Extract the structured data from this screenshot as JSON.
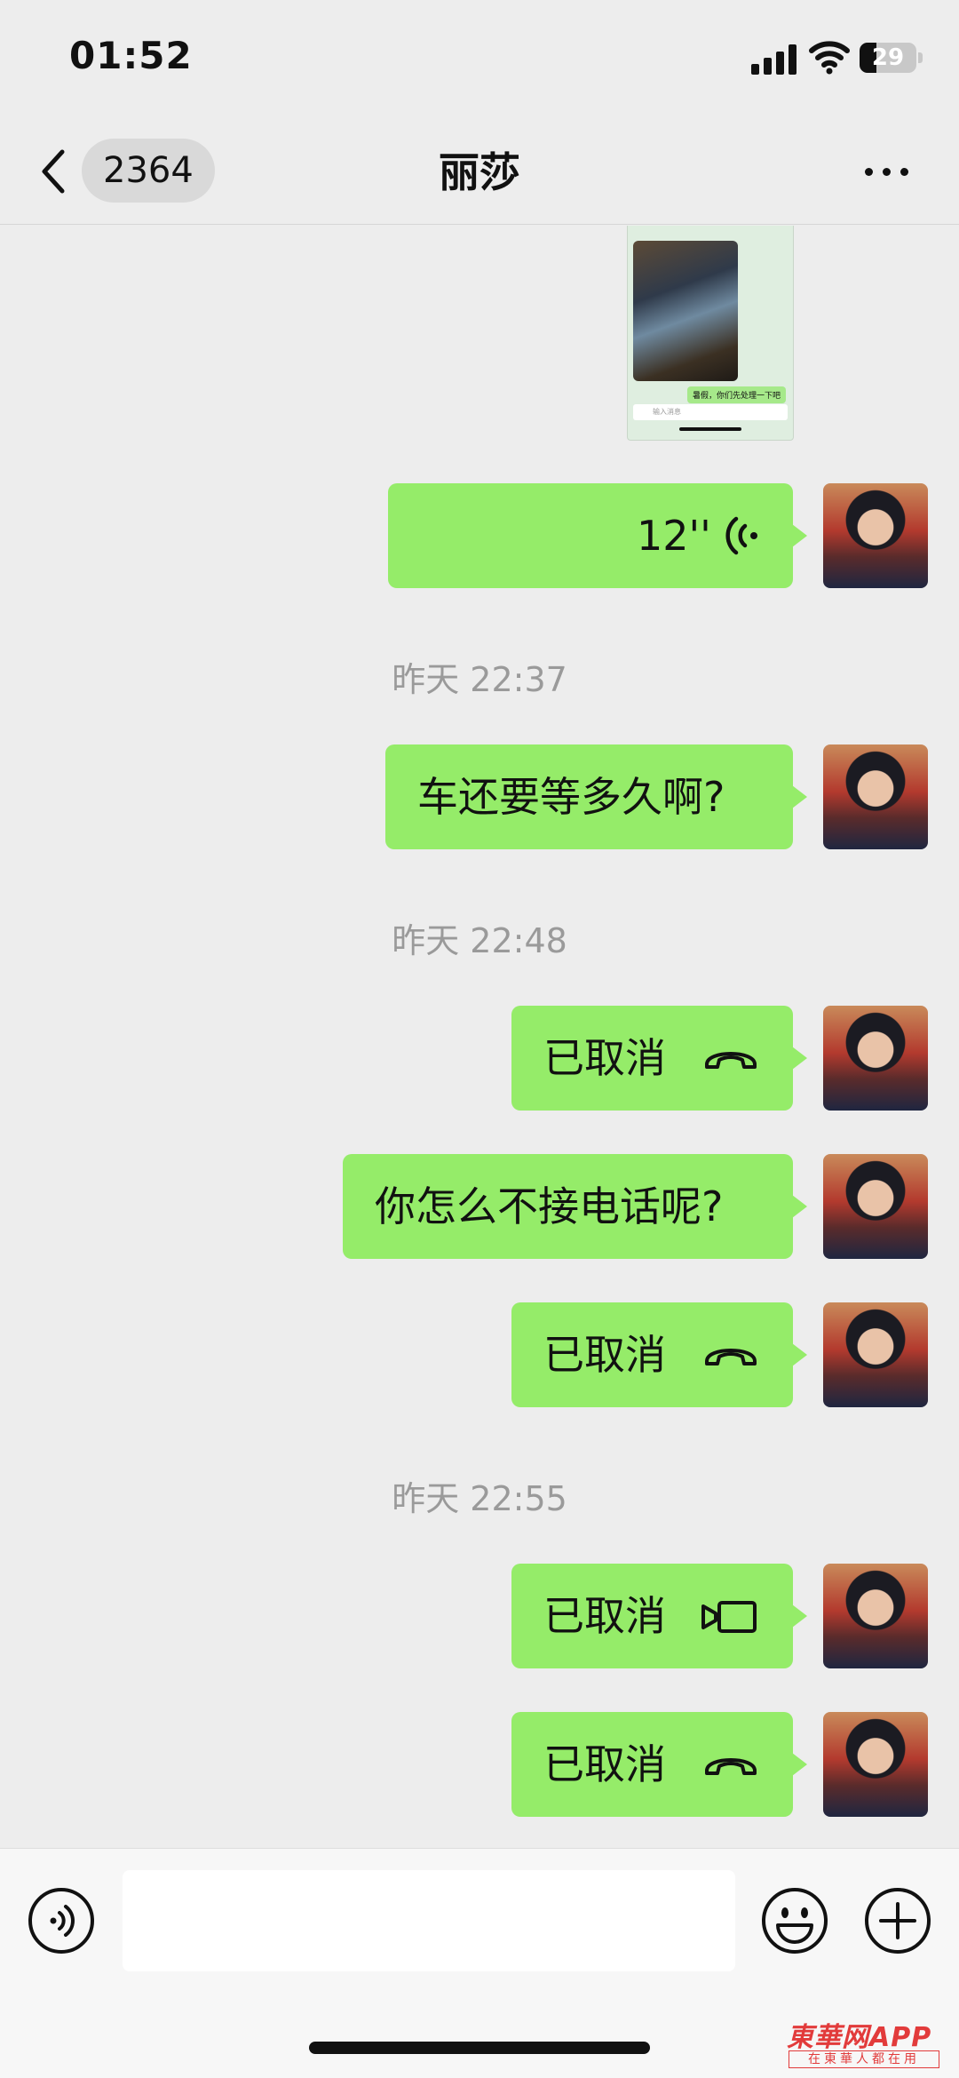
{
  "status_bar": {
    "time": "01:52",
    "battery_percent": "29",
    "battery_level": 0.29
  },
  "nav": {
    "unread_count": "2364",
    "title": "丽莎",
    "back_icon": "chevron-left-icon",
    "more_icon": "more-dots-icon"
  },
  "screenshot_thumb": {
    "caption": "暑假，你们先处理一下吧",
    "input_placeholder": "输入消息"
  },
  "messages": {
    "voice": {
      "duration": "12''",
      "icon": "voice-wave-icon"
    },
    "ts1": "昨天 22:37",
    "text1": "车还要等多久啊?",
    "ts2": "昨天 22:48",
    "call1": {
      "label": "已取消",
      "icon": "phone-hangup-icon"
    },
    "text2": "你怎么不接电话呢?",
    "call2": {
      "label": "已取消",
      "icon": "phone-hangup-icon"
    },
    "ts3": "昨天 22:55",
    "call3": {
      "label": "已取消",
      "icon": "video-call-icon"
    },
    "call4": {
      "label": "已取消",
      "icon": "phone-hangup-icon"
    }
  },
  "input_bar": {
    "text": "",
    "voice_icon": "voice-toggle-icon",
    "emoji_icon": "emoji-icon",
    "plus_icon": "plus-icon"
  },
  "watermark": {
    "main": "東華网APP",
    "sub": "在東華人都在用"
  },
  "colors": {
    "bubble_green": "#95ec69",
    "background": "#ededed",
    "watermark_red": "#e23b3b"
  }
}
